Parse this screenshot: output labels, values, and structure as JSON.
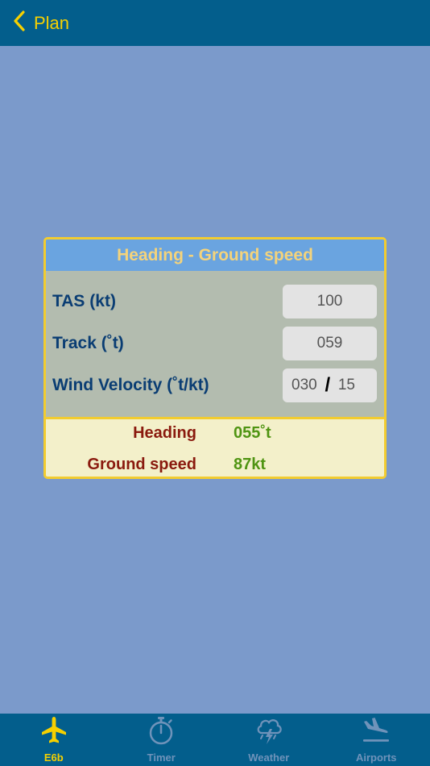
{
  "navbar": {
    "back_label": "Plan"
  },
  "card": {
    "title": "Heading - Ground speed",
    "rows": [
      {
        "label": "TAS (kt)",
        "value": "100"
      },
      {
        "label": "Track (˚t)",
        "value": "059"
      },
      {
        "label": "Wind Velocity (˚t/kt)",
        "direction": "030",
        "separator": "/",
        "speed": "15"
      }
    ],
    "results": [
      {
        "label": "Heading",
        "value": "055˚t"
      },
      {
        "label": "Ground speed",
        "value": "87kt"
      }
    ]
  },
  "tabs": [
    {
      "label": "E6b",
      "icon": "airplane-icon",
      "active": true
    },
    {
      "label": "Timer",
      "icon": "stopwatch-icon",
      "active": false
    },
    {
      "label": "Weather",
      "icon": "storm-cloud-icon",
      "active": false
    },
    {
      "label": "Airports",
      "icon": "plane-landing-icon",
      "active": false
    }
  ],
  "colors": {
    "background": "#7b9acb",
    "navbar": "#035e8c",
    "accent": "#f6d000",
    "card_header": "#6aa4e0",
    "card_border": "#f2cc30",
    "result_label": "#8a1a0e",
    "result_value": "#4f9412"
  }
}
